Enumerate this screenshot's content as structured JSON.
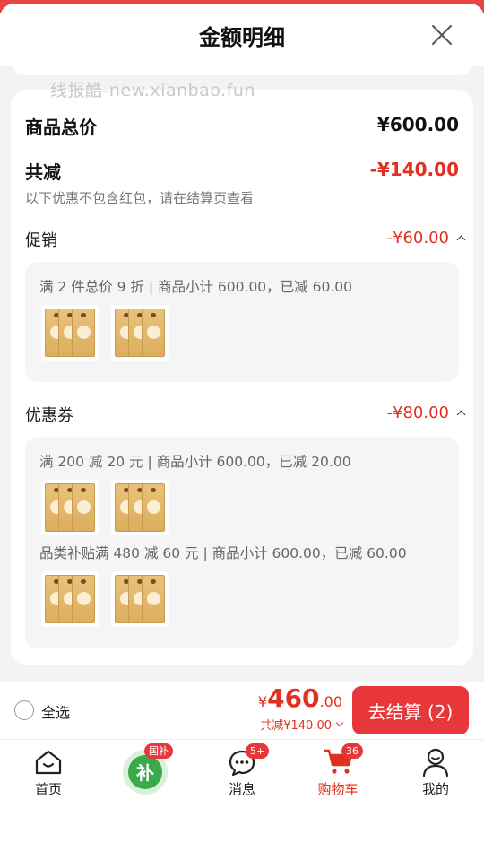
{
  "sheet": {
    "title": "金额明细",
    "watermark": "线报酷-new.xianbao.fun"
  },
  "summary": {
    "goods_total_label": "商品总价",
    "goods_total_value": "¥600.00",
    "discount_label": "共减",
    "discount_value": "-¥140.00",
    "note": "以下优惠不包含红包，请在结算页查看"
  },
  "promotion": {
    "label": "促销",
    "amount": "-¥60.00",
    "rule": "满 2 件总价 9 折 | 商品小计 600.00，已减 60.00"
  },
  "coupon": {
    "label": "优惠券",
    "amount": "-¥80.00",
    "rule1": "满 200 减 20 元 | 商品小计 600.00，已减 20.00",
    "rule2": "品类补贴满 480 减 60 元 | 商品小计 600.00，已减 60.00"
  },
  "bottom": {
    "select_all": "全选",
    "currency": "¥",
    "total_int": "460",
    "total_dec": ".00",
    "discount_line": "共减¥140.00",
    "checkout": "去结算 (2)"
  },
  "tabs": {
    "home": "首页",
    "subsidy_badge": "国补",
    "subsidy_glyph": "补",
    "messages": "消息",
    "messages_badge": "5+",
    "cart": "购物车",
    "cart_badge": "36",
    "mine": "我的"
  },
  "colors": {
    "accent": "#e1301f",
    "button": "#e8373a",
    "pack": "#e0b466"
  }
}
